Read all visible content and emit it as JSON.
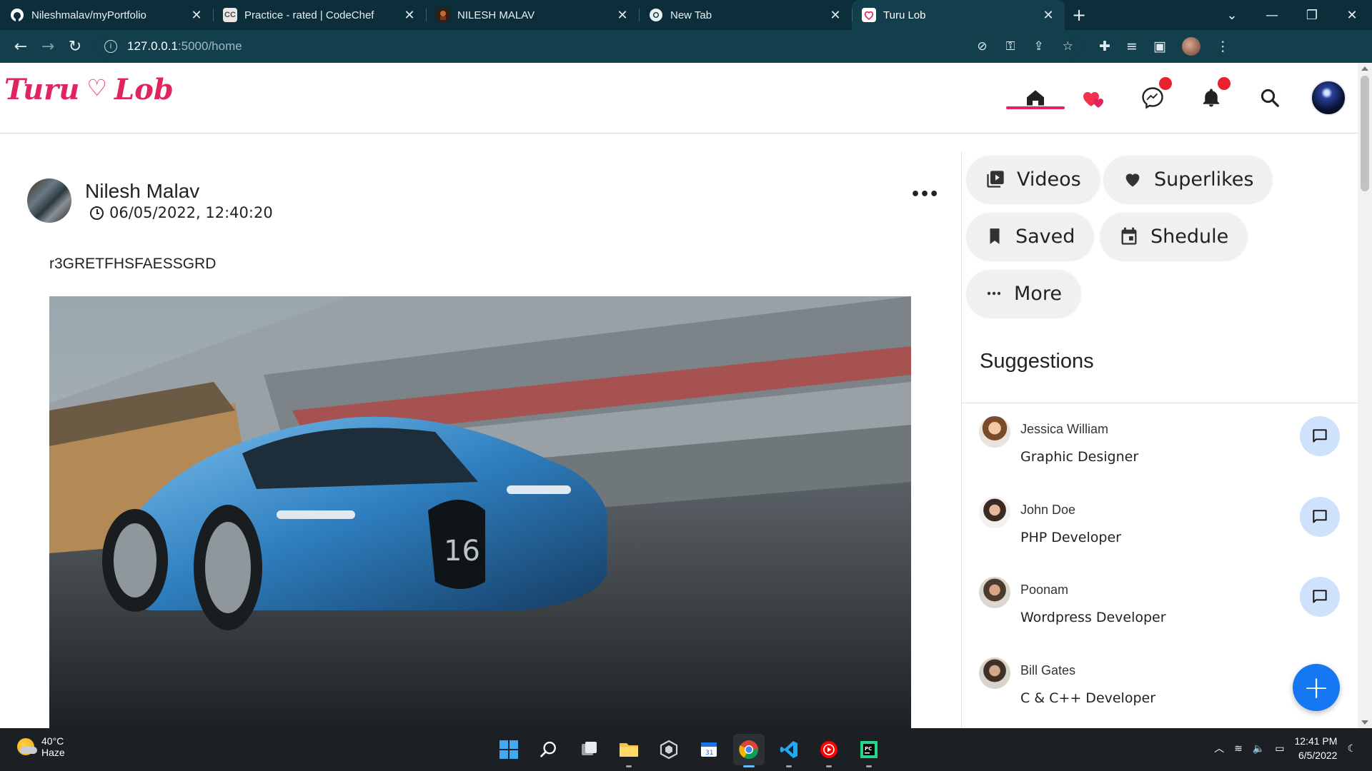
{
  "browser": {
    "tabs": [
      {
        "label": "Nileshmalav/myPortfolio",
        "icon": "github-icon",
        "active": false
      },
      {
        "label": "Practice - rated | CodeChef",
        "icon": "codechef-icon",
        "active": false
      },
      {
        "label": "NILESH MALAV",
        "icon": "portfolio-icon",
        "active": false
      },
      {
        "label": "New Tab",
        "icon": "chrome-icon",
        "active": false
      },
      {
        "label": "Turu Lob",
        "icon": "heart-icon",
        "active": true
      }
    ],
    "address": {
      "host": "127.0.0.1",
      "path": ":5000/home"
    }
  },
  "site": {
    "logo_left": "Turu",
    "logo_right": "Lob",
    "brand_color": "#e0245e",
    "nav_icons": [
      "home-icon",
      "superlike-hearts-icon",
      "messenger-icon",
      "bell-icon",
      "search-icon",
      "profile-avatar"
    ]
  },
  "post": {
    "author": "Nilesh Malav",
    "timestamp": "06/05/2022, 12:40:20",
    "text": "r3GRETFHSFAESSGRD",
    "more": "•••",
    "image_alt": "blue sports car racing on track"
  },
  "sidebar": {
    "chips": [
      {
        "label": "Videos",
        "icon": "video-library-icon"
      },
      {
        "label": "Superlikes",
        "icon": "heart-icon"
      },
      {
        "label": "Saved",
        "icon": "bookmark-icon"
      },
      {
        "label": "Shedule",
        "icon": "calendar-icon"
      },
      {
        "label": "More",
        "icon": "more-dots-icon"
      }
    ],
    "suggestions_title": "Suggestions",
    "suggestions": [
      {
        "name": "Jessica William",
        "role": "Graphic Designer"
      },
      {
        "name": "John Doe",
        "role": "PHP Developer"
      },
      {
        "name": "Poonam",
        "role": "Wordpress Developer"
      },
      {
        "name": "Bill Gates",
        "role": "C & C++ Developer"
      }
    ],
    "fab": "+"
  },
  "taskbar": {
    "weather_temp": "40°C",
    "weather_desc": "Haze",
    "time": "12:41 PM",
    "date": "6/5/2022"
  }
}
